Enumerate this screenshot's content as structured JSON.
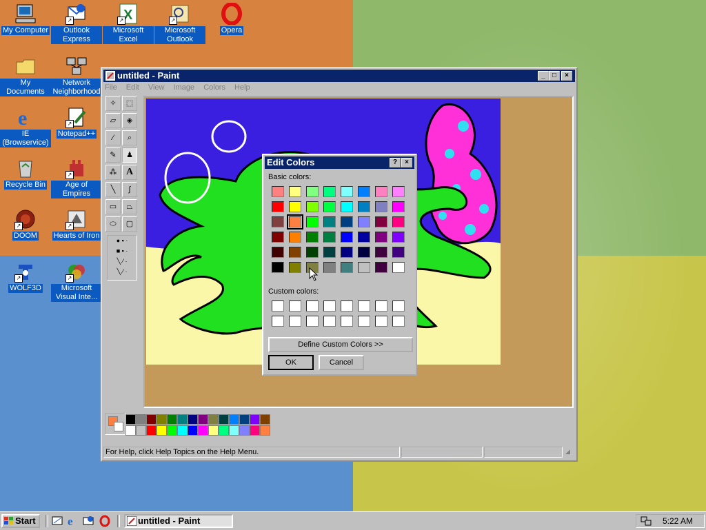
{
  "desktop": {
    "icons": [
      {
        "label": "My Computer",
        "icon": "computer-icon"
      },
      {
        "label": "Outlook Express",
        "icon": "outlook-express-icon"
      },
      {
        "label": "Microsoft Excel",
        "icon": "excel-icon"
      },
      {
        "label": "Microsoft Outlook",
        "icon": "outlook-icon"
      },
      {
        "label": "Opera",
        "icon": "opera-icon"
      },
      {
        "label": "My Documents",
        "icon": "folder-icon"
      },
      {
        "label": "Network Neighborhood",
        "icon": "network-icon"
      },
      {
        "label": "IE (Browservice)",
        "icon": "ie-icon"
      },
      {
        "label": "Notepad++",
        "icon": "notepad-icon"
      },
      {
        "label": "Recycle Bin",
        "icon": "recycle-bin-icon"
      },
      {
        "label": "Age of Empires",
        "icon": "age-of-empires-icon"
      },
      {
        "label": "DOOM",
        "icon": "doom-icon"
      },
      {
        "label": "Hearts of Iron",
        "icon": "hearts-of-iron-icon"
      },
      {
        "label": "WOLF3D",
        "icon": "wolf3d-icon"
      },
      {
        "label": "Microsoft Visual Inte...",
        "icon": "visual-interdev-icon"
      }
    ]
  },
  "paint": {
    "title": "untitled - Paint",
    "menu": [
      "File",
      "Edit",
      "View",
      "Image",
      "Colors",
      "Help"
    ],
    "status": "For Help, click Help Topics on the Help Menu.",
    "primary_color": "#ff8040",
    "secondary_color": "#ffffff",
    "palette_top": [
      "#000000",
      "#808080",
      "#800000",
      "#808000",
      "#008000",
      "#008080",
      "#000080",
      "#800080",
      "#808040",
      "#004040",
      "#0080ff",
      "#004080",
      "#8000ff",
      "#804000"
    ],
    "palette_bottom": [
      "#ffffff",
      "#c0c0c0",
      "#ff0000",
      "#ffff00",
      "#00ff00",
      "#00ffff",
      "#0000ff",
      "#ff00ff",
      "#ffff80",
      "#00ff80",
      "#80ffff",
      "#8080ff",
      "#ff0080",
      "#ff8040"
    ]
  },
  "dialog": {
    "title": "Edit Colors",
    "basic_label": "Basic colors:",
    "custom_label": "Custom colors:",
    "define_button": "Define Custom Colors >>",
    "ok_button": "OK",
    "cancel_button": "Cancel",
    "basic_colors": [
      [
        "#ff8080",
        "#ffff80",
        "#80ff80",
        "#00ff80",
        "#80ffff",
        "#0080ff",
        "#ff80c0",
        "#ff80ff"
      ],
      [
        "#ff0000",
        "#ffff00",
        "#80ff00",
        "#00ff40",
        "#00ffff",
        "#0080c0",
        "#8080c0",
        "#ff00ff"
      ],
      [
        "#804040",
        "#ff8040",
        "#00ff00",
        "#008080",
        "#004080",
        "#8080ff",
        "#800040",
        "#ff0080"
      ],
      [
        "#800000",
        "#ff8000",
        "#008000",
        "#008040",
        "#0000ff",
        "#0000a0",
        "#800080",
        "#8000ff"
      ],
      [
        "#400000",
        "#804000",
        "#004000",
        "#004040",
        "#000080",
        "#000040",
        "#400040",
        "#400080"
      ],
      [
        "#000000",
        "#808000",
        "#808040",
        "#808080",
        "#408080",
        "#c0c0c0",
        "#400040",
        "#ffffff"
      ]
    ],
    "selected_index": [
      2,
      1
    ]
  },
  "taskbar": {
    "start_label": "Start",
    "task_label": "untitled - Paint",
    "clock": "5:22 AM"
  }
}
